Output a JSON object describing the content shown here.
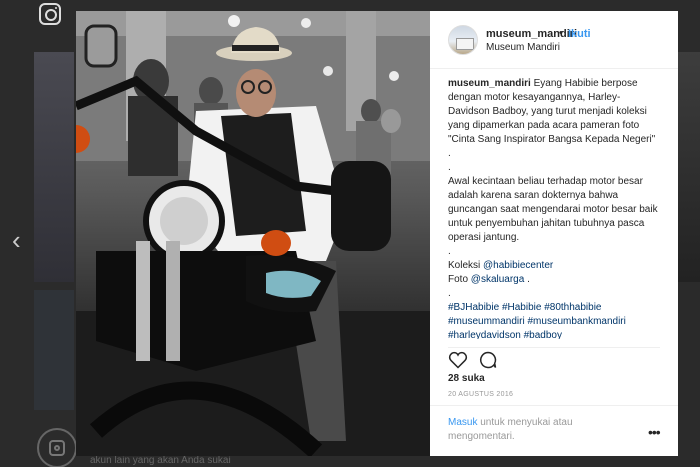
{
  "post": {
    "username": "museum_mandiri",
    "follow_label": "Ikuti",
    "separator": "•",
    "location": "Museum Mandiri",
    "caption_author": "museum_mandiri",
    "caption_line1": " Eyang Habibie berpose dengan motor kesayangannya, Harley-Davidson Badboy, yang turut menjadi koleksi yang dipamerkan pada acara pameran foto \"Cinta Sang Inspirator Bangsa Kepada Negeri\"",
    "dot1": ".",
    "dot2": ".",
    "caption_line2": "Awal kecintaan beliau terhadap motor besar adalah karena saran dokternya bahwa guncangan saat mengendarai motor besar baik untuk penyembuhan jahitan tubuhnya pasca operasi jantung.",
    "dot3": ".",
    "koleksi_label": "Koleksi ",
    "koleksi_handle": "@habibiecenter",
    "foto_label": "Foto ",
    "foto_handle": "@skaluarga",
    "foto_suffix": " .",
    "dot4": ".",
    "hashtags": [
      "#BJHabibie",
      "#Habibie",
      "#80thhabibie",
      "#museummandiri",
      "#museumbankmandiri",
      "#harleydavidson",
      "#badboy"
    ],
    "likes": "28 suka",
    "date": "20 AGUSTUS 2016",
    "comment_login": "Masuk",
    "comment_rest": " untuk menyukai atau mengomentari.",
    "more": "•••"
  },
  "background": {
    "caption_partial": "akun lain yang akan Anda sukai",
    "nav_prev": "‹"
  },
  "icons": {
    "like": "heart-icon",
    "comment": "comment-icon",
    "instagram": "instagram-icon"
  }
}
